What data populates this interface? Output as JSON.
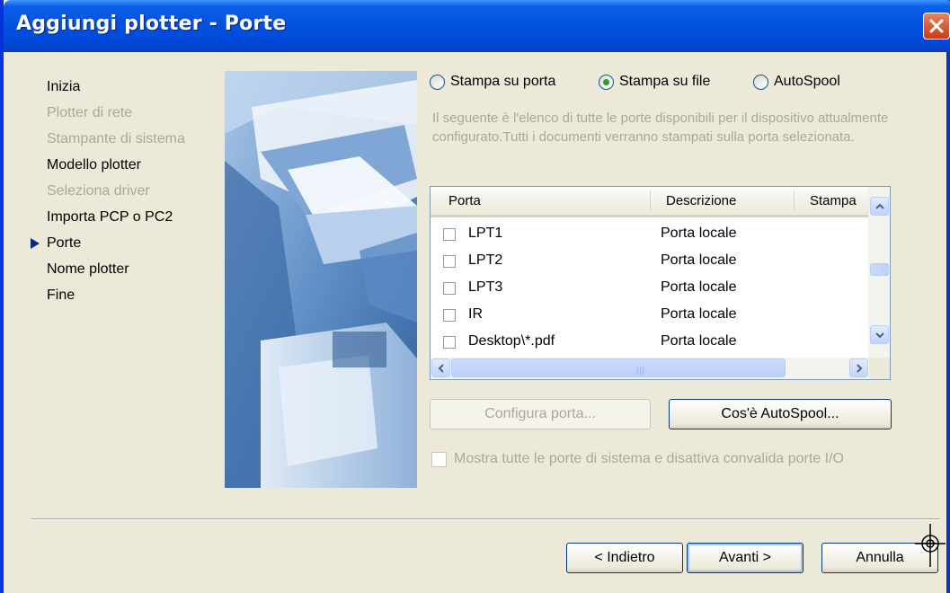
{
  "window": {
    "title": "Aggiungi plotter - Porte"
  },
  "steps": [
    {
      "label": "Inizia",
      "state": "normal"
    },
    {
      "label": "Plotter di rete",
      "state": "disabled"
    },
    {
      "label": "Stampante di sistema",
      "state": "disabled"
    },
    {
      "label": "Modello plotter",
      "state": "normal"
    },
    {
      "label": "Seleziona driver",
      "state": "disabled"
    },
    {
      "label": "Importa PCP o PC2",
      "state": "normal"
    },
    {
      "label": "Porte",
      "state": "current"
    },
    {
      "label": "Nome plotter",
      "state": "normal"
    },
    {
      "label": "Fine",
      "state": "normal"
    }
  ],
  "radios": [
    {
      "label": "Stampa su porta",
      "selected": false
    },
    {
      "label": "Stampa su file",
      "selected": true
    },
    {
      "label": "AutoSpool",
      "selected": false
    }
  ],
  "description": "Il seguente è l'elenco di tutte le porte disponibili per il dispositivo attualmente configurato.Tutti i documenti verranno stampati sulla porta selezionata.",
  "ports_list": {
    "columns": [
      "Porta",
      "Descrizione",
      "Stampa"
    ],
    "rows": [
      {
        "port": "LPT1",
        "description": "Porta locale",
        "checked": false
      },
      {
        "port": "LPT2",
        "description": "Porta locale",
        "checked": false
      },
      {
        "port": "LPT3",
        "description": "Porta locale",
        "checked": false
      },
      {
        "port": "IR",
        "description": "Porta locale",
        "checked": false
      },
      {
        "port": "Desktop\\*.pdf",
        "description": "Porta locale",
        "checked": false
      }
    ]
  },
  "buttons": {
    "configure_port": "Configura porta...",
    "what_is_autospool": "Cos'è AutoSpool...",
    "back": "< Indietro",
    "next": "Avanti >",
    "cancel": "Annulla"
  },
  "show_all_ports_label": "Mostra tutte le porte di sistema e disattiva convalida porte I/O",
  "colors": {
    "titlebar": "#0453e0",
    "dialog_bg": "#ece9d8",
    "disabled_text": "#aca899"
  },
  "icons": {
    "close": "close-icon",
    "current_step": "arrow-right-icon",
    "cursor": "crosshair-icon"
  }
}
